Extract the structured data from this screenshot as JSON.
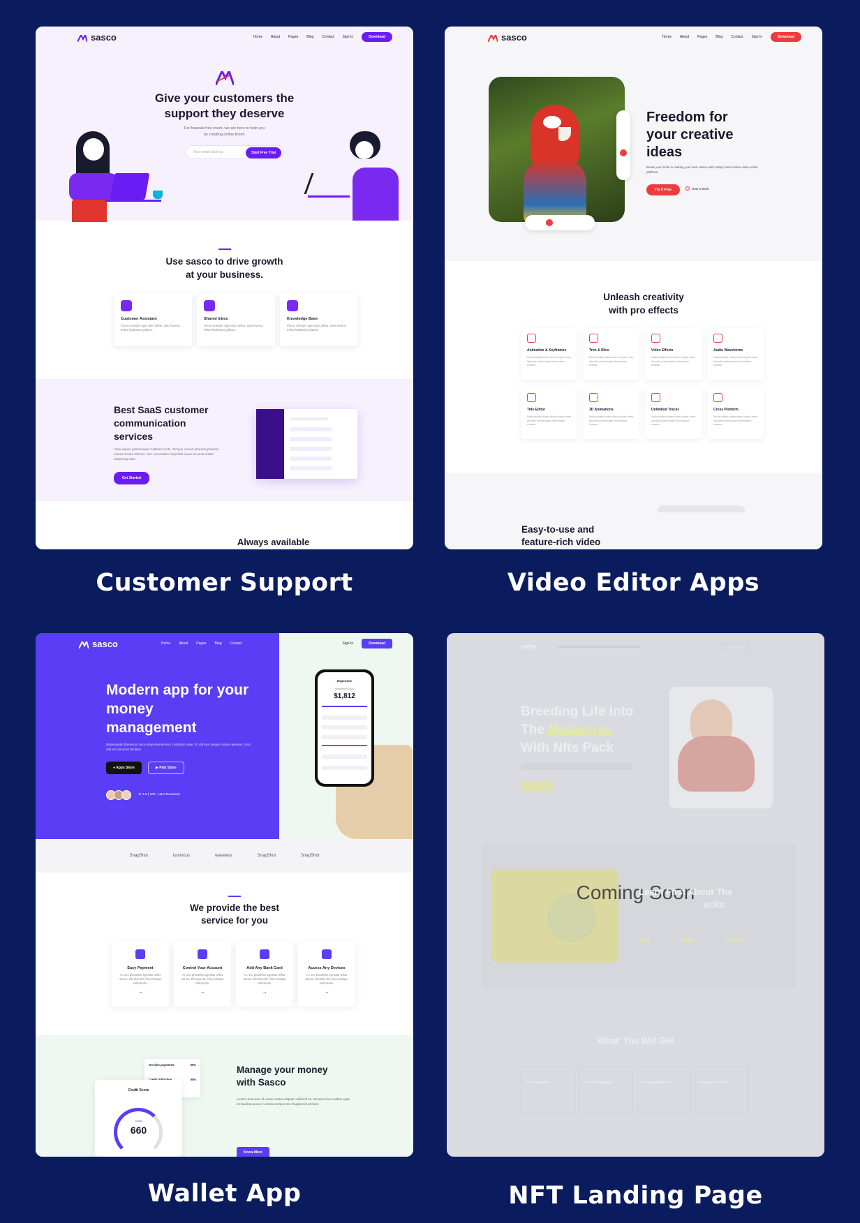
{
  "captions": {
    "customer_support": "Customer Support",
    "video_editor": "Video Editor Apps",
    "wallet": "Wallet App",
    "nft": "NFT Landing Page"
  },
  "colors": {
    "page_bg": "#0b1c5e",
    "purple": "#6a1cf5",
    "red": "#ef3b3b",
    "indigo": "#5b3df5"
  },
  "support": {
    "logo": "sasco",
    "nav": [
      "Home",
      "About",
      "Pages",
      "Blog",
      "Contact"
    ],
    "sign_in": "Sign In",
    "download": "Download",
    "hero_title_1": "Give your customers the",
    "hero_title_2": "support they deserve",
    "hero_sub_1": "For hassule free event, we are here to help you",
    "hero_sub_2": "by creating online ticket.",
    "email_placeholder": "Your email address",
    "cta": "Start Free Trial",
    "growth_1": "Use sasco to drive growth",
    "growth_2": "at your business.",
    "features": [
      {
        "title": "Customer Assistant",
        "desc": "Purus semper eget duis tellus. Sed viverra tellus habitasse platea."
      },
      {
        "title": "Shared Inbox",
        "desc": "Purus semper eget duis tellus. Sed viverra tellus habitasse platea."
      },
      {
        "title": "Knowledge Base",
        "desc": "Purus semper eget duis tellus. Sed viverra tellus habitasse platea."
      }
    ],
    "saas_1": "Best SaaS customer",
    "saas_2": "communication",
    "saas_3": "services",
    "saas_desc": "Vitae sapien pellentesque habitant morbi. Tempus urna et pharetra pharetra massa massa ultricies. Non consectetur imperdiet varius sit amet mattis adipiscing vitae.",
    "get_started": "Get Started",
    "always": "Always available"
  },
  "video": {
    "logo": "sasco",
    "nav": [
      "Home",
      "About",
      "Pages",
      "Blog",
      "Contact"
    ],
    "sign_in": "Sign In",
    "download": "Download",
    "hero_1": "Freedom for",
    "hero_2": "your creative",
    "hero_3": "ideas",
    "hero_sub": "Break your limits in making your best videos with today's best online video editor platform.",
    "try_free": "Try It Free",
    "how_it_works": "How It Work",
    "unleash_1": "Unleash creativity",
    "unleash_2": "with pro effects",
    "effects": [
      {
        "title": "Animation & Keyframes",
        "desc": "Nulla facilisi etiam diam it quis enim lobortis scelerisque fermentum massa."
      },
      {
        "title": "Trim & Slice",
        "desc": "Nulla facilisi etiam diam it quis enim lobortis scelerisque fermentum massa."
      },
      {
        "title": "Video Effects",
        "desc": "Nulla facilisi etiam diam it quis enim lobortis scelerisque fermentum massa."
      },
      {
        "title": "Audio Waveforms",
        "desc": "Nulla facilisi etiam diam it quis enim lobortis scelerisque fermentum massa."
      },
      {
        "title": "Title Editor",
        "desc": "Nulla facilisi etiam diam it quis enim lobortis scelerisque fermentum massa."
      },
      {
        "title": "3D Animations",
        "desc": "Nulla facilisi etiam diam it quis enim lobortis scelerisque fermentum massa."
      },
      {
        "title": "Unlimited Tracks",
        "desc": "Nulla facilisi etiam diam it quis enim lobortis scelerisque fermentum massa."
      },
      {
        "title": "Cross Platform",
        "desc": "Nulla facilisi etiam diam it quis enim lobortis scelerisque fermentum massa."
      }
    ],
    "easy_1": "Easy-to-use and",
    "easy_2": "feature-rich video"
  },
  "wallet": {
    "logo": "sasco",
    "nav": [
      "Home",
      "About",
      "Pages",
      "Blog",
      "Contact"
    ],
    "sign_in": "Sign In",
    "download": "Download",
    "hero_1": "Modern app for your",
    "hero_2": "money",
    "hero_3": "management",
    "hero_sub": "Malesuada bibendum arcu vitae elementum curabitur vitae. Et ultrices neque ornare aenean. Non nisl est sit amet facilisis.",
    "app_store": "Apps Store",
    "play_store": "Paly Store",
    "rating": "4.8 ( 10k+ User Reviews)",
    "phone_title": "Expenses",
    "phone_label": "September 2020",
    "phone_amount": "$1,812",
    "brands": [
      "SnapShot",
      "luminous",
      "waveless",
      "SnapShot",
      "SnapShot"
    ],
    "provide_1": "We provide the best",
    "provide_2": "service for you",
    "services": [
      {
        "title": "Easy Payment",
        "desc": "Ac orci phasellus egestas tellus rutrum. Elit duis the intro tristique sollicitudin."
      },
      {
        "title": "Control Your Account",
        "desc": "Ac orci phasellus egestas tellus rutrum. Elit duis the intro tristique sollicitudin."
      },
      {
        "title": "Add Any Bank Card",
        "desc": "Ac orci phasellus egestas tellus rutrum. Elit duis the intro tristique sollicitudin."
      },
      {
        "title": "Access Any Devices",
        "desc": "Ac orci phasellus egestas tellus rutrum. Elit duis the intro tristique sollicitudin."
      }
    ],
    "ontime": "On-time payments",
    "ontime_val": "95%",
    "credit_util": "Credit Utilization",
    "credit_val": "95%",
    "credit_score_label": "Credit Score",
    "score": "660",
    "score_tag": "Good",
    "manage_1": "Manage your money",
    "manage_2": "with Sasco",
    "manage_desc": "Auctor urna nunc id cursus metus aliquam eleifend mi. Sit amet risus nullam eget. Ut faucibus purus in massa tempor nec feugiat nisl pretium.",
    "know_more": "Know More"
  },
  "nft": {
    "logo": "sasly.",
    "hero_1": "Breeding Life Into",
    "hero_2a": "The ",
    "hero_2b": "Metaverse",
    "hero_3": "With Nfts Pack",
    "coming_soon": "Coming Soon",
    "learn": "Learn First About The",
    "punks": "unks",
    "stats": [
      "99%",
      "$1M",
      "2100%"
    ],
    "what": "What' You Will Get",
    "items": [
      "1/1 Unique NFTs",
      "Over 250 Properties",
      "Ownership Benefits",
      "Professional Artists"
    ]
  }
}
